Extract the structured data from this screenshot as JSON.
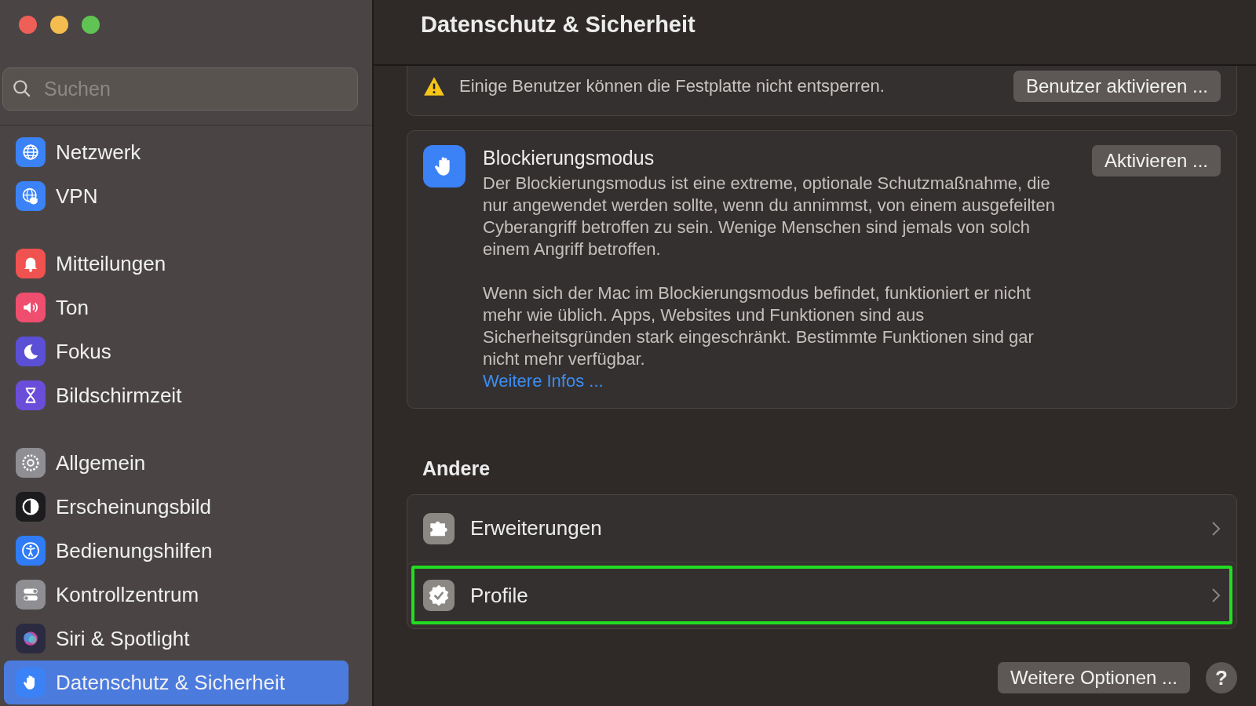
{
  "search": {
    "placeholder": "Suchen"
  },
  "sidebar": {
    "groups": [
      [
        {
          "label": "Netzwerk",
          "color": "#3b82f6",
          "selected": false
        },
        {
          "label": "VPN",
          "color": "#3b82f6",
          "selected": false
        }
      ],
      [
        {
          "label": "Mitteilungen",
          "color": "#f0524f",
          "selected": false
        },
        {
          "label": "Ton",
          "color": "#ef4e6f",
          "selected": false
        },
        {
          "label": "Fokus",
          "color": "#5b4fd6",
          "selected": false
        },
        {
          "label": "Bildschirmzeit",
          "color": "#6a4ed9",
          "selected": false
        }
      ],
      [
        {
          "label": "Allgemein",
          "color": "#8e8e93",
          "selected": false
        },
        {
          "label": "Erscheinungsbild",
          "color": "#1c1c1e",
          "selected": false
        },
        {
          "label": "Bedienungshilfen",
          "color": "#2f7cf6",
          "selected": false
        },
        {
          "label": "Kontrollzentrum",
          "color": "#8e8e93",
          "selected": false
        },
        {
          "label": "Siri & Spotlight",
          "color": "#2a2a40",
          "selected": false
        },
        {
          "label": "Datenschutz & Sicherheit",
          "color": "#3b82f6",
          "selected": true
        }
      ]
    ]
  },
  "header": {
    "title": "Datenschutz & Sicherheit"
  },
  "warning": {
    "text": "Einige Benutzer können die Festplatte nicht entsperren.",
    "button": "Benutzer aktivieren ..."
  },
  "lockdown": {
    "title": "Blockierungsmodus",
    "button": "Aktivieren ...",
    "paragraphs": [
      "Der Blockierungsmodus ist eine extreme, optionale Schutzmaßnahme, die nur angewendet werden sollte, wenn du annimmst, von einem ausgefeilten Cyberangriff betroffen zu sein. Wenige Menschen sind jemals von solch einem Angriff betroffen.",
      "Wenn sich der Mac im Blockierungsmodus befindet, funktioniert er nicht mehr wie üblich. Apps, Websites und Funktionen sind aus Sicherheitsgründen stark eingeschränkt. Bestimmte Funktionen sind gar nicht mehr verfügbar."
    ],
    "link": "Weitere Infos ..."
  },
  "other": {
    "heading": "Andere",
    "rows": [
      {
        "label": "Erweiterungen",
        "highlighted": false
      },
      {
        "label": "Profile",
        "highlighted": true
      }
    ]
  },
  "footer": {
    "button": "Weitere Optionen ...",
    "help": "?"
  }
}
